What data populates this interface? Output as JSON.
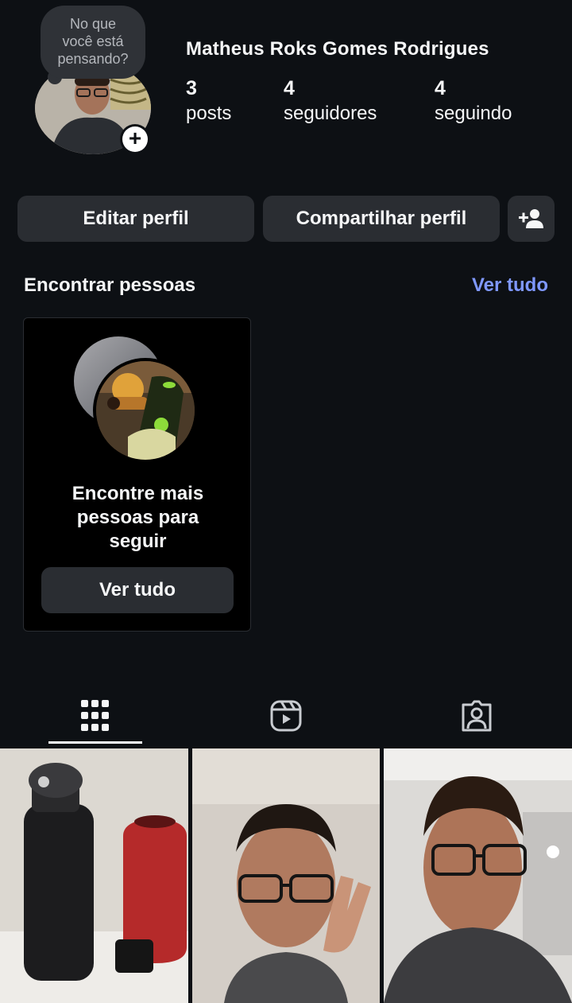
{
  "profile": {
    "note": {
      "lines": [
        "No que",
        "você está",
        "pensando?"
      ]
    },
    "add_story_glyph": "+",
    "username": "Matheus Roks Gomes Rodrigues",
    "stats": [
      {
        "value": "3",
        "label": "posts"
      },
      {
        "value": "4",
        "label": "seguidores"
      },
      {
        "value": "4",
        "label": "seguindo"
      }
    ]
  },
  "actions": {
    "edit_label": "Editar perfil",
    "share_label": "Compartilhar perfil",
    "add_user_icon": "add-person-icon"
  },
  "find_people": {
    "title": "Encontrar pessoas",
    "see_all": "Ver tudo",
    "card": {
      "text_lines": [
        "Encontre mais",
        "pessoas para",
        "seguir"
      ],
      "button_label": "Ver tudo"
    }
  },
  "tabs": [
    {
      "name": "grid",
      "icon": "grid-icon",
      "active": true
    },
    {
      "name": "reels",
      "icon": "reels-icon",
      "active": false
    },
    {
      "name": "tagged",
      "icon": "tagged-person-icon",
      "active": false
    }
  ],
  "colors": {
    "background": "#0d1014",
    "button": "#2a2d32",
    "link": "#7f98ff"
  }
}
